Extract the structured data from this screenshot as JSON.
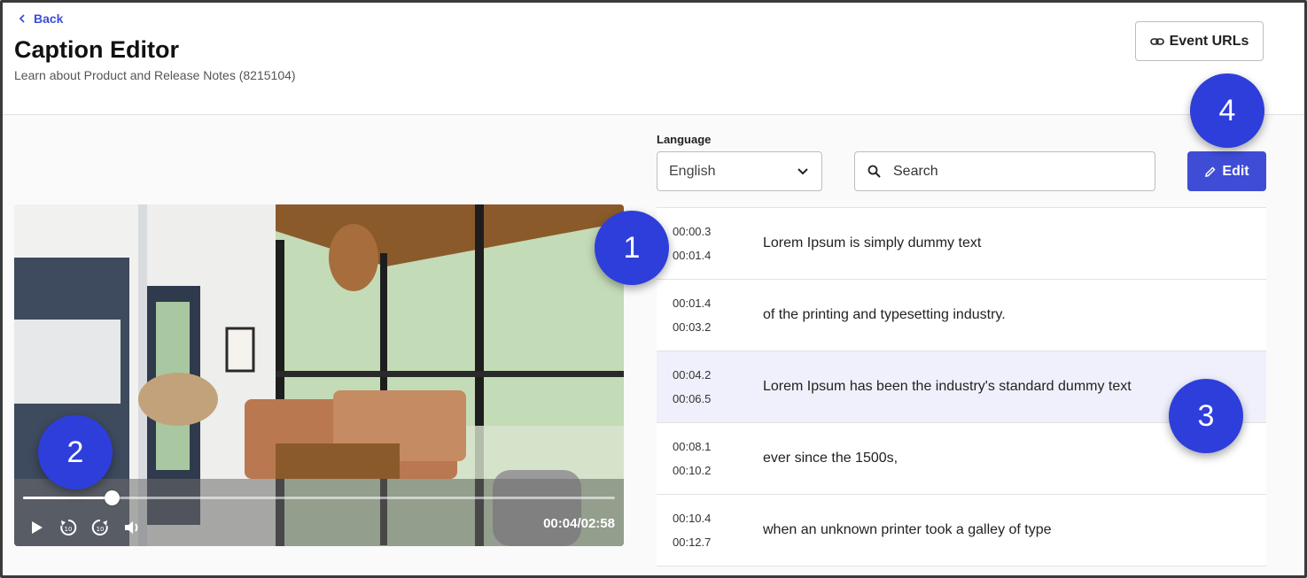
{
  "header": {
    "back_label": "Back",
    "title": "Caption Editor",
    "subtitle": "Learn about Product and Release Notes (8215104)",
    "event_urls_label": "Event URLs"
  },
  "player": {
    "current_time": "00:04",
    "duration": "02:58",
    "time_display": "00:04/02:58",
    "progress": 0.15
  },
  "controls": {
    "language_label": "Language",
    "language_value": "English",
    "search_placeholder": "Search",
    "edit_label": "Edit"
  },
  "captions": [
    {
      "start": "00:00.3",
      "end": "00:01.4",
      "text": "Lorem Ipsum is simply dummy text",
      "active": false
    },
    {
      "start": "00:01.4",
      "end": "00:03.2",
      "text": "of the printing and typesetting industry.",
      "active": false
    },
    {
      "start": "00:04.2",
      "end": "00:06.5",
      "text": "Lorem Ipsum has been the industry's standard dummy text",
      "active": true
    },
    {
      "start": "00:08.1",
      "end": "00:10.2",
      "text": "ever since the 1500s,",
      "active": false
    },
    {
      "start": "00:10.4",
      "end": "00:12.7",
      "text": "when an unknown printer took a galley of type",
      "active": false
    }
  ],
  "markers": [
    "1",
    "2",
    "3",
    "4"
  ],
  "colors": {
    "accent": "#3f4cd6",
    "marker": "#2e3edb",
    "active_row": "#eff0fb"
  }
}
